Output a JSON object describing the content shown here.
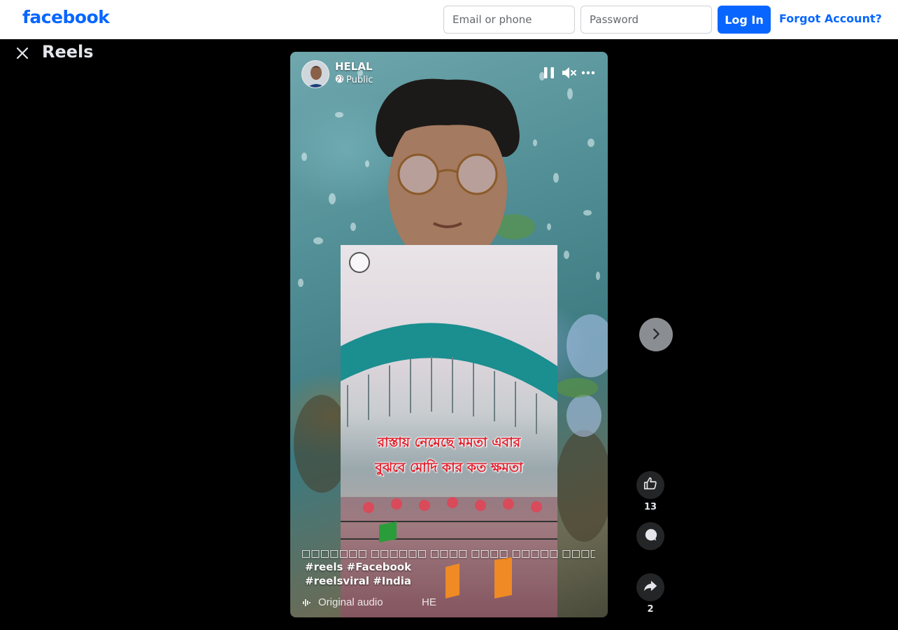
{
  "header": {
    "logo": "facebook",
    "email_placeholder": "Email or phone",
    "password_placeholder": "Password",
    "login_label": "Log In",
    "forgot_label": "Forgot Account?",
    "brand_color": "#0866ff"
  },
  "reels": {
    "title": "Reels",
    "close_icon": "close-icon",
    "next_icon": "chevron-right-icon"
  },
  "post": {
    "author": "HELAL",
    "privacy": "Public",
    "privacy_icon": "globe-icon",
    "controls": [
      "pause-icon",
      "mute-icon",
      "more-icon"
    ],
    "video_text_line1": "রাস্তায় নেমেছে মমতা এবার",
    "video_text_line2": "বুঝবে মোদি কার কত ক্ষমতা",
    "caption_text": "□□□□□□□ □□□□□□ □□□□ □□□□ □□□□□ □□□□ □□□ □□ □□□□□□",
    "hashtags": [
      "#reels",
      "#Facebook",
      "#reelsviral",
      "#India"
    ],
    "audio_label": "Original audio",
    "audio_author": "HE"
  },
  "actions": {
    "like_count": "13",
    "share_count": "2"
  }
}
